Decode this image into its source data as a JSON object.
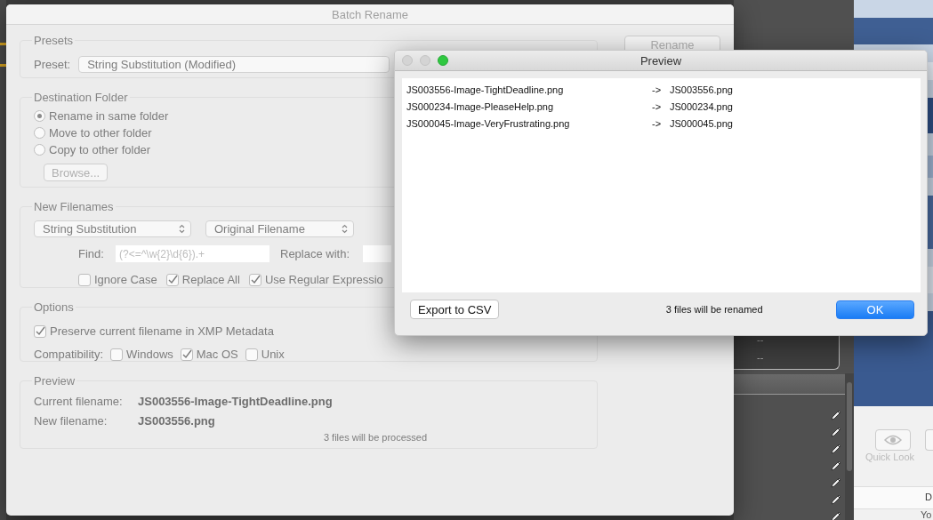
{
  "background": {
    "panel_values": [
      "--",
      "--"
    ],
    "quick_look": {
      "label": "Quick Look"
    },
    "table_header": "D",
    "table_cell": "Yo",
    "pen_count_rows": [
      {},
      {},
      {},
      {},
      {},
      {},
      {}
    ]
  },
  "batch_rename": {
    "title": "Batch Rename",
    "rename_button": {
      "label": "Rename",
      "disabled": true
    },
    "presets": {
      "heading": "Presets",
      "label": "Preset:",
      "value": "String Substitution (Modified)"
    },
    "destination": {
      "heading": "Destination Folder",
      "options": [
        {
          "label": "Rename in same folder",
          "selected": true
        },
        {
          "label": "Move to other folder",
          "selected": false
        },
        {
          "label": "Copy to other folder",
          "selected": false
        }
      ],
      "browse_button": {
        "label": "Browse...",
        "disabled": true
      }
    },
    "new_filenames": {
      "heading": "New Filenames",
      "method": "String Substitution",
      "source": "Original Filename",
      "find_label": "Find:",
      "find_value": "(?<=^\\w{2}\\d{6}).+",
      "replace_label": "Replace with:",
      "checkboxes": [
        {
          "label": "Ignore Case",
          "checked": false
        },
        {
          "label": "Replace All",
          "checked": true
        },
        {
          "label": "Use Regular Expressio",
          "checked": true
        }
      ]
    },
    "options": {
      "heading": "Options",
      "preserve": {
        "label": "Preserve current filename in XMP Metadata",
        "checked": true
      },
      "compat_label": "Compatibility:",
      "compat": [
        {
          "label": "Windows",
          "checked": false
        },
        {
          "label": "Mac OS",
          "checked": true
        },
        {
          "label": "Unix",
          "checked": false
        }
      ]
    },
    "preview": {
      "heading": "Preview",
      "current_label": "Current filename:",
      "current_value": "JS003556-Image-TightDeadline.png",
      "new_label": "New filename:",
      "new_value": "JS003556.png",
      "status": "3 files will be processed"
    }
  },
  "preview_window": {
    "title": "Preview",
    "rows": [
      {
        "from": "JS003556-Image-TightDeadline.png",
        "arrow": "->",
        "to": "JS003556.png"
      },
      {
        "from": "JS000234-Image-PleaseHelp.png",
        "arrow": "->",
        "to": "JS000234.png"
      },
      {
        "from": "JS000045-Image-VeryFrustrating.png",
        "arrow": "->",
        "to": "JS000045.png"
      }
    ],
    "export_button": "Export to CSV",
    "status": "3 files will be renamed",
    "ok_button": "OK"
  }
}
